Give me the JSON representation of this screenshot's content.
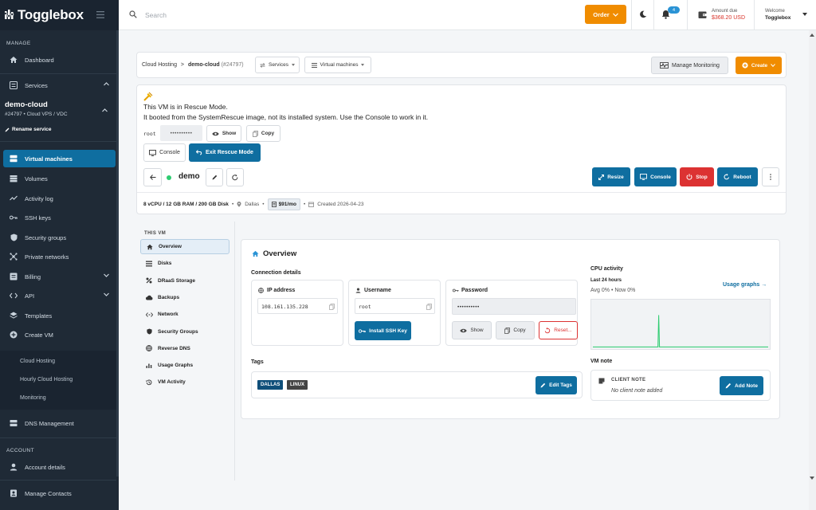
{
  "brand": {
    "name": "Togglebox"
  },
  "sidebar": {
    "manage_label": "MANAGE",
    "dashboard": "Dashboard",
    "services": "Services",
    "service_name": "demo-cloud",
    "service_meta": "#24797 • Cloud VPS / VDC",
    "rename": "Rename service",
    "items": [
      {
        "label": "Virtual machines",
        "icon": "server-icon"
      },
      {
        "label": "Volumes",
        "icon": "database-icon"
      },
      {
        "label": "Activity log",
        "icon": "activity-icon"
      },
      {
        "label": "SSH keys",
        "icon": "key-icon"
      },
      {
        "label": "Security groups",
        "icon": "shield-icon"
      },
      {
        "label": "Private networks",
        "icon": "network-icon"
      },
      {
        "label": "Billing",
        "icon": "billing-icon"
      },
      {
        "label": "API",
        "icon": "code-icon"
      },
      {
        "label": "Templates",
        "icon": "layers-icon"
      },
      {
        "label": "Create VM",
        "icon": "plus-circle-icon"
      }
    ],
    "sub_items": [
      "Cloud Hosting",
      "Hourly Cloud Hosting",
      "Monitoring"
    ],
    "dns": "DNS Management",
    "account_label": "ACCOUNT",
    "account_details": "Account details",
    "manage_contacts": "Manage Contacts"
  },
  "topbar": {
    "search_placeholder": "Search",
    "order_label": "Order",
    "notification_count": "4",
    "amount_label": "Amount due",
    "amount_value": "$368.20 USD",
    "welcome_label": "Welcome",
    "username": "Togglebox"
  },
  "breadcrumb": {
    "root": "Cloud Hosting",
    "sep": ">",
    "service": "demo-cloud",
    "service_id": "(#24797)",
    "services_dd": "Services",
    "vms_dd": "Virtual machines",
    "manage_monitoring": "Manage Monitoring",
    "create": "Create"
  },
  "rescue": {
    "title": "This VM is in Rescue Mode.",
    "message": "It booted from the SystemRescue image, not its installed system. Use the Console to work in it.",
    "user": "root",
    "password_mask": "••••••••••",
    "show": "Show",
    "copy": "Copy",
    "console": "Console",
    "exit": "Exit Rescue Mode"
  },
  "vm": {
    "name": "demo",
    "status_color": "#2ecc71",
    "resize": "Resize",
    "console": "Console",
    "stop": "Stop",
    "reboot": "Reboot",
    "specs": "8 vCPU / 12 GB RAM / 200 GB Disk",
    "sep": "•",
    "location": "Dallas",
    "price": "$91/mo",
    "created": "Created 2026-04-23"
  },
  "tabs": {
    "heading": "THIS VM",
    "items": [
      {
        "label": "Overview",
        "icon": "home-icon"
      },
      {
        "label": "Disks",
        "icon": "disks-icon"
      },
      {
        "label": "DRaaS Storage",
        "icon": "draas-icon"
      },
      {
        "label": "Backups",
        "icon": "cloud-icon"
      },
      {
        "label": "Network",
        "icon": "network-icon"
      },
      {
        "label": "Security Groups",
        "icon": "shield-icon"
      },
      {
        "label": "Reverse DNS",
        "icon": "globe-icon"
      },
      {
        "label": "Usage Graphs",
        "icon": "bar-chart-icon"
      },
      {
        "label": "VM Activity",
        "icon": "history-icon"
      }
    ]
  },
  "overview": {
    "title": "Overview",
    "connection_details": "Connection details",
    "ip_label": "IP address",
    "ip_value": "108.161.135.228",
    "username_label": "Username",
    "username_value": "root",
    "install_ssh": "Install SSH Key",
    "password_label": "Password",
    "password_mask": "••••••••••",
    "show": "Show",
    "copy": "Copy",
    "reset": "Reset...",
    "tags_label": "Tags",
    "tags": [
      "DALLAS",
      "LINUX"
    ],
    "edit_tags": "Edit Tags",
    "cpu_title": "CPU activity",
    "cpu_range": "Last 24 hours",
    "cpu_avg": "Avg 0% • Now 0%",
    "usage_graphs": "Usage graphs →",
    "vm_note": "VM note",
    "client_note": "CLIENT NOTE",
    "no_note": "No client note added",
    "add_note": "Add Note"
  },
  "chart_data": {
    "type": "area",
    "title": "CPU activity",
    "xlabel": "",
    "ylabel": "",
    "ylim": [
      0,
      100
    ],
    "series": [
      {
        "values": [
          1,
          1,
          1,
          1,
          1,
          1,
          1,
          1,
          1,
          1,
          1,
          1,
          1,
          1,
          1,
          1,
          1,
          1,
          1,
          1,
          1,
          1,
          1,
          1,
          1,
          1,
          1,
          1,
          1,
          1,
          1,
          1,
          1,
          1,
          1,
          1,
          1,
          1,
          1,
          1,
          1,
          1,
          1,
          1,
          1,
          1,
          1,
          1,
          1,
          1,
          1,
          1,
          1,
          1,
          1,
          1,
          1,
          1,
          1,
          1,
          1,
          1,
          1,
          1,
          1,
          1,
          1,
          1,
          1,
          1,
          1,
          1,
          1,
          1,
          1,
          1,
          1,
          1,
          1,
          1,
          1,
          1,
          1,
          1,
          1,
          1,
          1,
          1,
          1,
          1,
          1,
          1,
          1,
          1,
          1,
          1,
          1,
          1,
          1,
          1,
          1,
          1,
          1,
          1,
          1,
          1,
          1,
          1,
          1,
          1,
          1,
          1,
          1,
          1,
          1,
          1,
          1,
          1,
          1,
          1,
          1,
          1,
          1,
          1,
          1,
          1,
          1,
          1,
          1,
          1,
          1,
          1,
          1,
          1,
          1,
          1,
          1,
          1,
          1,
          1,
          1,
          1,
          1,
          1,
          1,
          1,
          1,
          1,
          1,
          1,
          1,
          1,
          1,
          1,
          1,
          1,
          1,
          1,
          1,
          1,
          1,
          1,
          1,
          1,
          1,
          1,
          1,
          1,
          1,
          1,
          1,
          1,
          1,
          1,
          1,
          1,
          1,
          1,
          1,
          1,
          1,
          1,
          1,
          1,
          1,
          1,
          1,
          1,
          1,
          1,
          1,
          1,
          1,
          1,
          1,
          1,
          1,
          1,
          1,
          1,
          1,
          1,
          1,
          1,
          1,
          1,
          1,
          1,
          1,
          1,
          1,
          1,
          1,
          1,
          1,
          1,
          1,
          1,
          1,
          1,
          1,
          1
        ]
      }
    ],
    "color": "#2ecc71",
    "spike_index": 83,
    "spike_value": 70,
    "grid": false
  }
}
